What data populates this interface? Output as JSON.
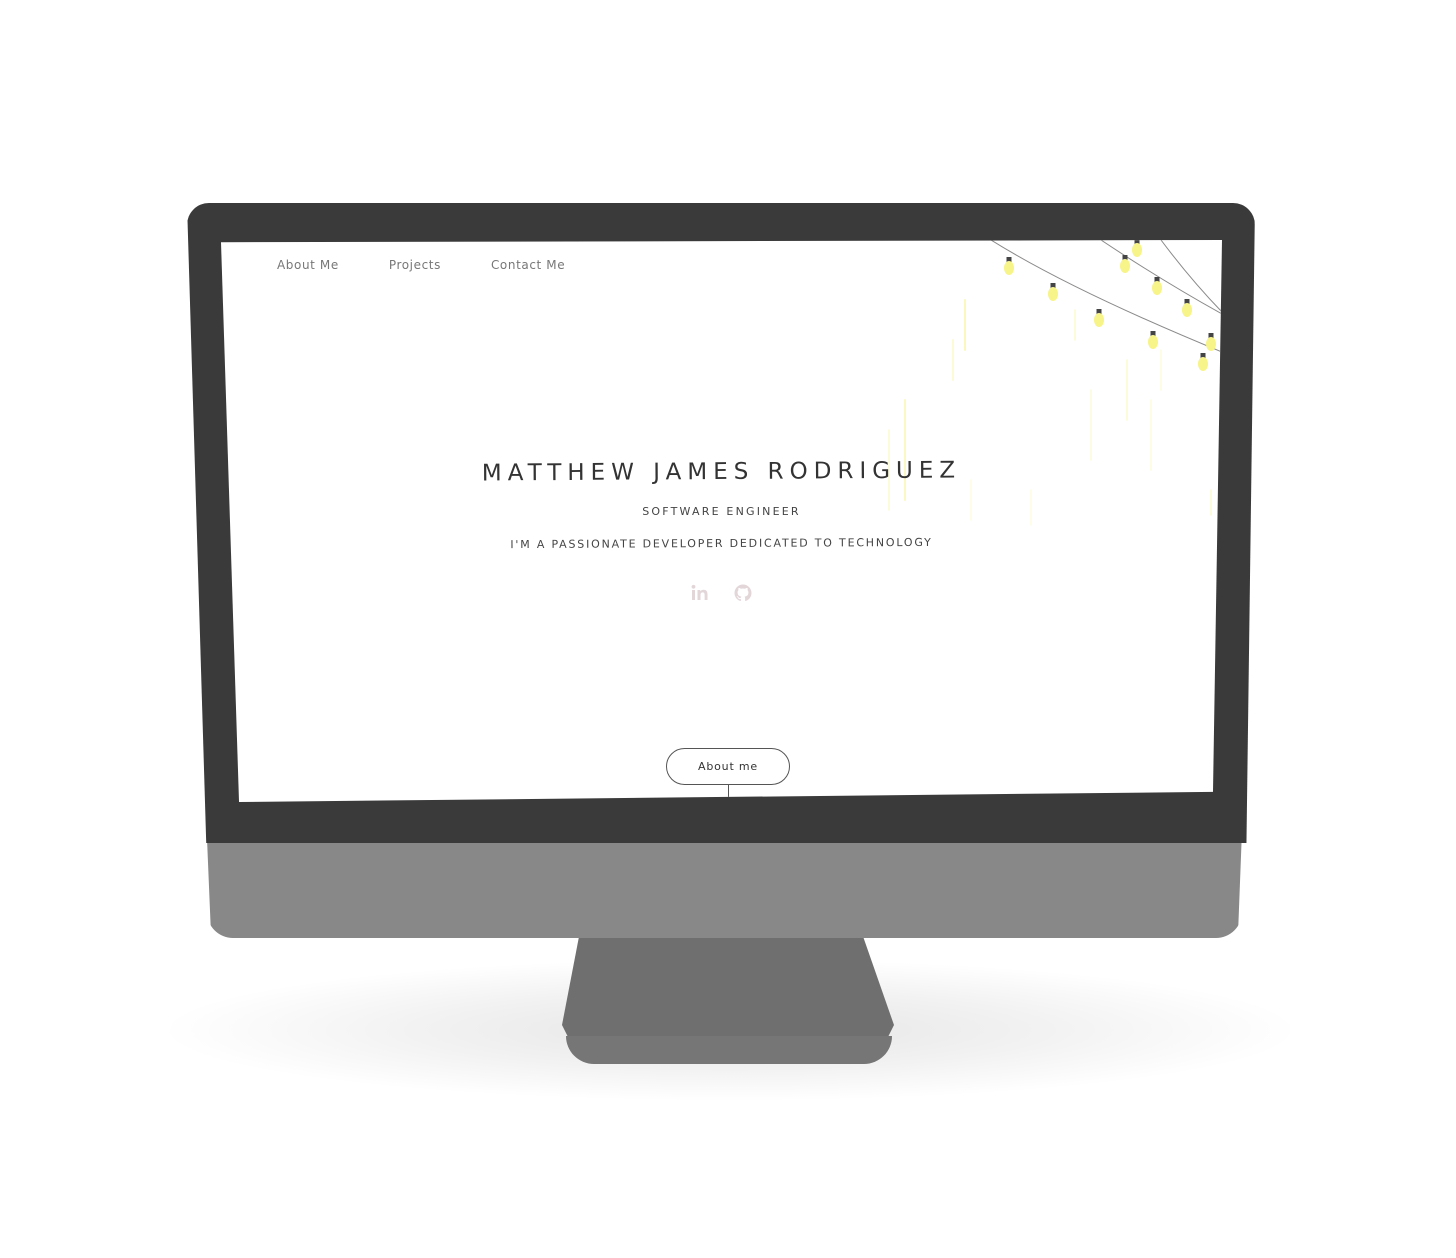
{
  "nav": {
    "items": [
      {
        "label": "About Me"
      },
      {
        "label": "Projects"
      },
      {
        "label": "Contact Me"
      }
    ]
  },
  "hero": {
    "name": "MATTHEW JAMES RODRIGUEZ",
    "role": "SOFTWARE ENGINEER",
    "tagline": "I'M A PASSIONATE DEVELOPER DEDICATED TO TECHNOLOGY"
  },
  "socials": [
    {
      "icon": "linkedin-icon"
    },
    {
      "icon": "github-icon"
    }
  ],
  "cta": {
    "label": "About me"
  },
  "colors": {
    "bezel": "#3a3a3a",
    "chin": "#888888",
    "stand": "#6f6f6f",
    "text": "#333333",
    "nav_text": "#777777",
    "social_icon": "#e3d6d9",
    "bulb": "#f7f48a"
  }
}
